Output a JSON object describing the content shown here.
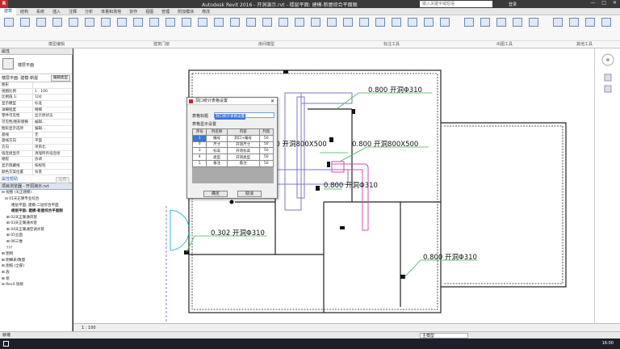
{
  "app": {
    "icon_letter": "R",
    "title": "Autodesk Revit 2016 -   开洞演示.rvt - 楼层平面: 建模-新屋综合平面图",
    "search_placeholder": "键入关键字或短语",
    "user": "登录"
  },
  "ribbon_tabs": [
    "建筑",
    "结构",
    "系统",
    "插入",
    "注释",
    "分析",
    "体量和场地",
    "协作",
    "视图",
    "管理",
    "附加模块",
    "修改"
  ],
  "ribbon_groups": [
    "模型编辑",
    "建筑门窗",
    "房间模型",
    "标注工具",
    "出图工具",
    "其他工具"
  ],
  "properties": {
    "header": "属性",
    "type_name": "楼层平面",
    "filter_label": "楼层平面: 建模-新屋",
    "edit_type": "编辑类型",
    "rows": [
      {
        "k": "图形",
        "v": ""
      },
      {
        "k": "视图比例",
        "v": "1 : 100"
      },
      {
        "k": "比例值 1:",
        "v": "100"
      },
      {
        "k": "显示模型",
        "v": "标准"
      },
      {
        "k": "详细程度",
        "v": "精细"
      },
      {
        "k": "零件可见性",
        "v": "显示原状态"
      },
      {
        "k": "可见性/图形替换",
        "v": "编辑..."
      },
      {
        "k": "图形显示选项",
        "v": "编辑..."
      },
      {
        "k": "基线",
        "v": "无"
      },
      {
        "k": "基线方向",
        "v": "平面"
      },
      {
        "k": "方向",
        "v": "项目北"
      },
      {
        "k": "墙连接显示",
        "v": "清理所有墙连接"
      },
      {
        "k": "规程",
        "v": "协调"
      },
      {
        "k": "显示隐藏线",
        "v": "按规程"
      },
      {
        "k": "颜色方案位置",
        "v": "背景"
      }
    ],
    "help": "属性帮助",
    "apply": "应用"
  },
  "browser": {
    "header": "项目浏览器 - 开洞演示.rvt",
    "items": [
      {
        "text": "⊟ 视图 (天正建模)",
        "indent": 2,
        "bold": false
      },
      {
        "text": "⊟ 01天正算专业综合",
        "indent": 6,
        "bold": false
      },
      {
        "text": "楼层平面: 建模-二层综合平面",
        "indent": 14,
        "bold": false
      },
      {
        "text": "楼层平面: 建模-新屋综合平面图",
        "indent": 14,
        "bold": true
      },
      {
        "text": "⊞ 02天正暖通风管",
        "indent": 8,
        "bold": false
      },
      {
        "text": "⊞ 03天正暖通水管",
        "indent": 8,
        "bold": false
      },
      {
        "text": "⊞ 04天正暖通空调水管",
        "indent": 8,
        "bold": false
      },
      {
        "text": "⊞ 05立面",
        "indent": 8,
        "bold": false
      },
      {
        "text": "⊞ 06三维",
        "indent": 8,
        "bold": false
      },
      {
        "text": "???",
        "indent": 8,
        "bold": false
      },
      {
        "text": "⊞ 图例",
        "indent": 2,
        "bold": false
      },
      {
        "text": "⊞ 明细表/数量",
        "indent": 2,
        "bold": false
      },
      {
        "text": "⊞ 图纸 (全部)",
        "indent": 2,
        "bold": false
      },
      {
        "text": "⊞ 族",
        "indent": 2,
        "bold": false
      },
      {
        "text": "⊞ 组",
        "indent": 2,
        "bold": false
      },
      {
        "text": "⊕ Revit 链接",
        "indent": 2,
        "bold": false
      }
    ]
  },
  "annotations": [
    {
      "text": "0.800 开洞Φ310"
    },
    {
      "text": "00 开洞800X500"
    },
    {
      "text": "0.800 开洞800X500"
    },
    {
      "text": "0.800 开洞Φ310"
    },
    {
      "text": "0.302 开洞Φ310"
    },
    {
      "text": "0.800 开洞Φ310"
    }
  ],
  "dialog": {
    "title": "洞口统计表格设置",
    "name_label": "表格标题",
    "name_value": "洞口统计表格设置",
    "content_label": "表格显示设置",
    "columns": [
      "序号",
      "列名称",
      "内容",
      "列宽"
    ],
    "rows": [
      [
        "1",
        "编号",
        "洞口+编号",
        "50"
      ],
      [
        "0",
        "尺寸",
        "开洞尺寸",
        "50"
      ],
      [
        "3",
        "标高",
        "开洞标高",
        "50"
      ],
      [
        "4",
        "类型",
        "开洞类型",
        "50"
      ],
      [
        "5",
        "备注",
        "备注",
        "50"
      ]
    ],
    "ok": "确定",
    "cancel": "取消"
  },
  "viewbar": {
    "scale": "1 : 100"
  },
  "statusbar": {
    "left": "就绪",
    "right": "主模型"
  },
  "taskbar": {
    "time": "16:00"
  }
}
